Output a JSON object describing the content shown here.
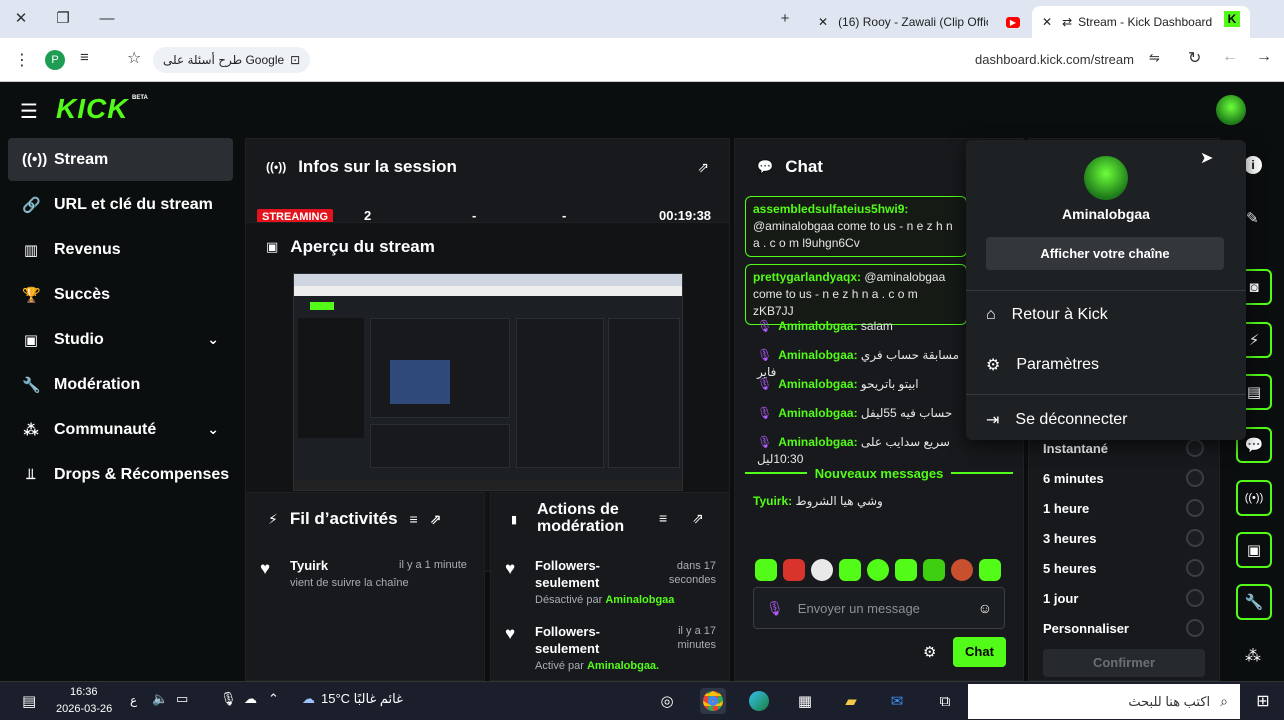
{
  "browser": {
    "tabs": [
      {
        "title": "(16) Rooy - Zawali (Clip Officiel)"
      },
      {
        "title": "Stream - Kick Dashboard"
      }
    ],
    "url": "dashboard.kick.com/stream",
    "search_pill": "طرح أسئلة على Google",
    "profile_letter": "P"
  },
  "header": {
    "logo": "KICK",
    "beta": "BETA"
  },
  "sidebar": {
    "items": [
      {
        "label": "Stream"
      },
      {
        "label": "URL et clé du stream"
      },
      {
        "label": "Revenus"
      },
      {
        "label": "Succès"
      },
      {
        "label": "Studio"
      },
      {
        "label": "Modération"
      },
      {
        "label": "Communauté"
      },
      {
        "label": "Drops & Récompenses"
      }
    ]
  },
  "session": {
    "title": "Infos sur la session",
    "badge": "STREAMING",
    "viewers": "2",
    "col3": "-",
    "col4": "-",
    "duration": "00:19:38"
  },
  "preview": {
    "title": "Aperçu du stream"
  },
  "activity": {
    "title": "Fil d’activités",
    "item": {
      "user": "Tyuirk",
      "time": "il y a 1 minute",
      "text": "vient de suivre la chaîne"
    }
  },
  "modactions": {
    "title": "Actions de modération",
    "items": [
      {
        "title": "Followers-seulement",
        "time": "dans 17 secondes",
        "prefix": "Désactivé par",
        "user": "Aminalobgaa"
      },
      {
        "title": "Followers-seulement",
        "time": "il y a 17 minutes",
        "prefix": "Activé par",
        "user": "Aminalobgaa."
      }
    ]
  },
  "chat": {
    "title": "Chat",
    "highlighted": [
      {
        "user": "assembledsulfateius5hwi9:",
        "text": "@aminalobgaa come to us - n e z h n a . c o m l9uhgn6Cv"
      },
      {
        "user": "prettygarlandyaqx:",
        "text": "@aminalobgaa come to us - n e z h n a . c o m zKB7JJ"
      }
    ],
    "messages": [
      {
        "user": "Aminalobgaa:",
        "text": "salam"
      },
      {
        "user": "Aminalobgaa:",
        "text": "مسابقة حساب فري فاير"
      },
      {
        "user": "Aminalobgaa:",
        "text": "ابيتو باتريحو"
      },
      {
        "user": "Aminalobgaa:",
        "text": "حساب فيه 55ليفل"
      },
      {
        "user": "Aminalobgaa:",
        "text": "سريع سدايب على 10:30ليل"
      }
    ],
    "new_messages_label": "Nouveaux messages",
    "new_message": {
      "user": "Tyuirk:",
      "text": "وشي هيا الشروط"
    },
    "input_placeholder": "Envoyer un message",
    "send_label": "Chat"
  },
  "slowmode": {
    "options": [
      "Instantané",
      "6 minutes",
      "1 heure",
      "3 heures",
      "5 heures",
      "1 jour",
      "Personnaliser"
    ],
    "confirm": "Confirmer"
  },
  "usermenu": {
    "username": "Aminalobgaa",
    "channel_button": "Afficher votre chaîne",
    "items": [
      {
        "label": "Retour à Kick"
      },
      {
        "label": "Paramètres"
      },
      {
        "label": "Se déconnecter"
      }
    ]
  },
  "taskbar": {
    "time": "16:36",
    "date": "2026-03-26",
    "weather": "15°C  غائم غالبًا",
    "lang": "ع",
    "search_placeholder": "اكتب هنا للبحث"
  },
  "colors": {
    "brand": "#53fc18",
    "panel": "#17191c",
    "background": "#0b0e0f",
    "badge": "#e1141e"
  }
}
